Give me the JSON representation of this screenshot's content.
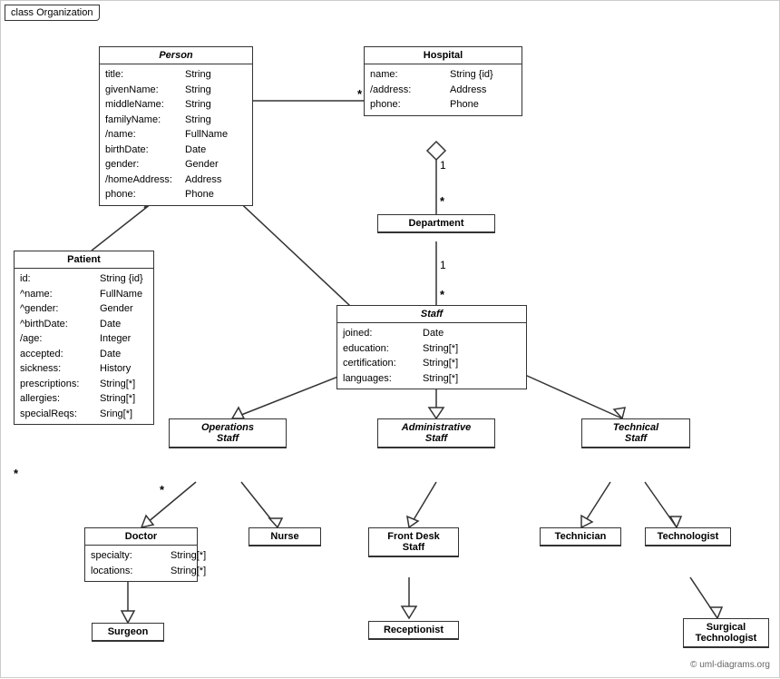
{
  "diagram": {
    "title": "class Organization",
    "watermark": "© uml-diagrams.org",
    "classes": {
      "person": {
        "name": "Person",
        "italic": true,
        "attrs": [
          {
            "name": "title:",
            "type": "String"
          },
          {
            "name": "givenName:",
            "type": "String"
          },
          {
            "name": "middleName:",
            "type": "String"
          },
          {
            "name": "familyName:",
            "type": "String"
          },
          {
            "name": "/name:",
            "type": "FullName"
          },
          {
            "name": "birthDate:",
            "type": "Date"
          },
          {
            "name": "gender:",
            "type": "Gender"
          },
          {
            "name": "/homeAddress:",
            "type": "Address"
          },
          {
            "name": "phone:",
            "type": "Phone"
          }
        ]
      },
      "hospital": {
        "name": "Hospital",
        "italic": false,
        "attrs": [
          {
            "name": "name:",
            "type": "String {id}"
          },
          {
            "name": "/address:",
            "type": "Address"
          },
          {
            "name": "phone:",
            "type": "Phone"
          }
        ]
      },
      "department": {
        "name": "Department",
        "italic": false,
        "attrs": []
      },
      "staff": {
        "name": "Staff",
        "italic": true,
        "attrs": [
          {
            "name": "joined:",
            "type": "Date"
          },
          {
            "name": "education:",
            "type": "String[*]"
          },
          {
            "name": "certification:",
            "type": "String[*]"
          },
          {
            "name": "languages:",
            "type": "String[*]"
          }
        ]
      },
      "patient": {
        "name": "Patient",
        "italic": false,
        "attrs": [
          {
            "name": "id:",
            "type": "String {id}"
          },
          {
            "name": "^name:",
            "type": "FullName"
          },
          {
            "name": "^gender:",
            "type": "Gender"
          },
          {
            "name": "^birthDate:",
            "type": "Date"
          },
          {
            "name": "/age:",
            "type": "Integer"
          },
          {
            "name": "accepted:",
            "type": "Date"
          },
          {
            "name": "sickness:",
            "type": "History"
          },
          {
            "name": "prescriptions:",
            "type": "String[*]"
          },
          {
            "name": "allergies:",
            "type": "String[*]"
          },
          {
            "name": "specialReqs:",
            "type": "Sring[*]"
          }
        ]
      },
      "operations_staff": {
        "name": "Operations Staff",
        "italic": true
      },
      "administrative_staff": {
        "name": "Administrative Staff",
        "italic": true
      },
      "technical_staff": {
        "name": "Technical Staff",
        "italic": true
      },
      "doctor": {
        "name": "Doctor",
        "italic": false,
        "attrs": [
          {
            "name": "specialty:",
            "type": "String[*]"
          },
          {
            "name": "locations:",
            "type": "String[*]"
          }
        ]
      },
      "nurse": {
        "name": "Nurse",
        "italic": false,
        "attrs": []
      },
      "front_desk_staff": {
        "name": "Front Desk Staff",
        "italic": false,
        "attrs": []
      },
      "technician": {
        "name": "Technician",
        "italic": false,
        "attrs": []
      },
      "technologist": {
        "name": "Technologist",
        "italic": false,
        "attrs": []
      },
      "surgeon": {
        "name": "Surgeon",
        "italic": false,
        "attrs": []
      },
      "receptionist": {
        "name": "Receptionist",
        "italic": false,
        "attrs": []
      },
      "surgical_technologist": {
        "name": "Surgical Technologist",
        "italic": false,
        "attrs": []
      }
    }
  }
}
